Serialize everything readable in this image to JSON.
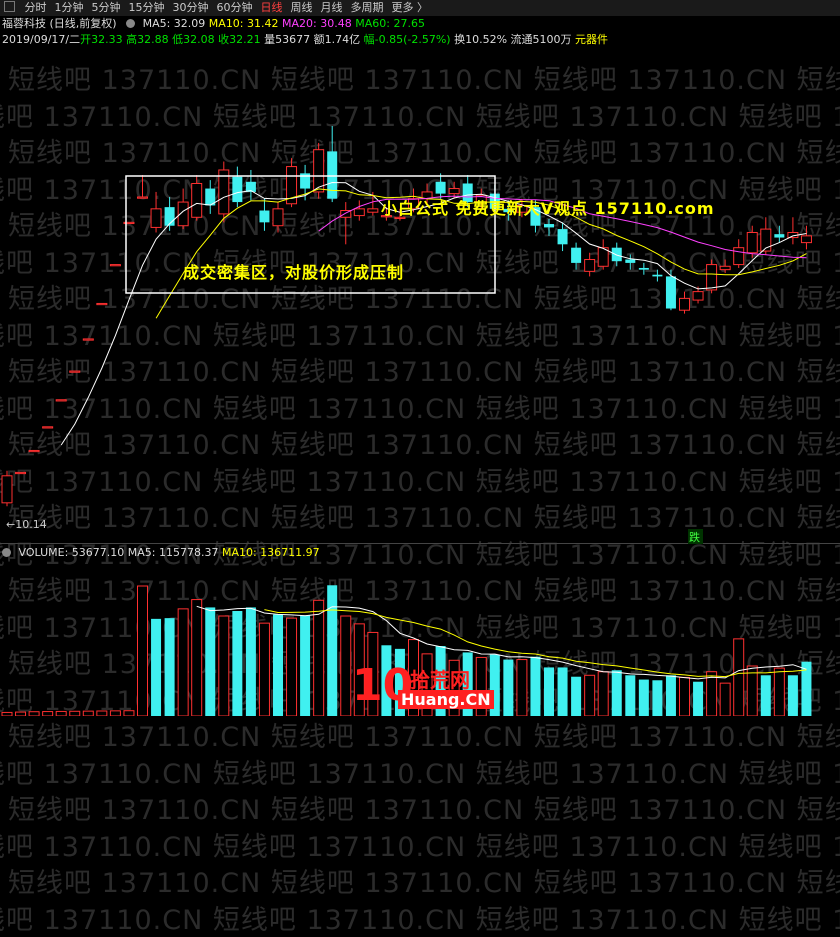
{
  "tabs": [
    {
      "label": "分时",
      "active": false
    },
    {
      "label": "1分钟",
      "active": false
    },
    {
      "label": "5分钟",
      "active": false
    },
    {
      "label": "15分钟",
      "active": false
    },
    {
      "label": "30分钟",
      "active": false
    },
    {
      "label": "60分钟",
      "active": false
    },
    {
      "label": "日线",
      "active": true
    },
    {
      "label": "周线",
      "active": false
    },
    {
      "label": "月线",
      "active": false
    },
    {
      "label": "多周期",
      "active": false
    },
    {
      "label": "更多 〉",
      "active": false
    }
  ],
  "header": {
    "stock": "福蓉科技 (日线,前复权)",
    "ma5": "MA5: 32.09",
    "ma10": "MA10: 31.42",
    "ma20": "MA20: 30.48",
    "ma60": "MA60: 27.65",
    "date": "2019/09/17/二",
    "open": "开32.33",
    "high": "高32.88",
    "low": "低32.08",
    "close": "收32.21",
    "volume": "量53677",
    "amount": "额1.74亿",
    "change": "幅-0.85(-2.57%)",
    "turnover": "换10.52%",
    "float": "流通5100万",
    "tool": "元器件"
  },
  "volume_header": {
    "volume": "VOLUME: 53677.10",
    "ma5": "MA5: 115778.37",
    "ma10": "MA10: 136711.97"
  },
  "annotations": {
    "dense_zone": "成交密集区，对股价形成压制",
    "promo": "小白公式 免费更新大V观点 157110.com"
  },
  "low_label": "←10.14",
  "badge": "跌",
  "watermark": "短线吧 137110.CN",
  "logo": {
    "ten": "10",
    "cn1": "拾荒网",
    "cn2": "Huang.CN"
  },
  "colors": {
    "up": "#ff3030",
    "down": "#40f0f0",
    "ma5": "#ffffff",
    "ma10": "#ffff00",
    "ma20": "#ff40ff",
    "ma60": "#00e000"
  },
  "chart_data": {
    "type": "candlestick",
    "price_ylim": [
      9,
      38
    ],
    "candles": [
      {
        "o": 11.2,
        "c": 12.8,
        "h": 13.1,
        "l": 11.0
      },
      {
        "o": 13.0,
        "c": 13.0,
        "h": 13.0,
        "l": 13.0
      },
      {
        "o": 14.3,
        "c": 14.3,
        "h": 14.3,
        "l": 14.3
      },
      {
        "o": 15.7,
        "c": 15.7,
        "h": 15.7,
        "l": 15.7
      },
      {
        "o": 17.3,
        "c": 17.3,
        "h": 17.3,
        "l": 17.3
      },
      {
        "o": 19.0,
        "c": 19.0,
        "h": 19.0,
        "l": 19.0
      },
      {
        "o": 20.9,
        "c": 20.9,
        "h": 20.9,
        "l": 20.9
      },
      {
        "o": 23.0,
        "c": 23.0,
        "h": 23.0,
        "l": 23.0
      },
      {
        "o": 25.3,
        "c": 25.3,
        "h": 25.3,
        "l": 25.3
      },
      {
        "o": 27.8,
        "c": 27.8,
        "h": 27.8,
        "l": 27.8
      },
      {
        "o": 29.3,
        "c": 29.3,
        "h": 30.6,
        "l": 29.3
      },
      {
        "o": 27.5,
        "c": 28.6,
        "h": 29.6,
        "l": 27.2
      },
      {
        "o": 28.7,
        "c": 27.6,
        "h": 29.3,
        "l": 27.3
      },
      {
        "o": 27.6,
        "c": 29.0,
        "h": 29.8,
        "l": 27.4
      },
      {
        "o": 28.1,
        "c": 30.1,
        "h": 30.6,
        "l": 27.9
      },
      {
        "o": 29.8,
        "c": 28.8,
        "h": 30.3,
        "l": 28.3
      },
      {
        "o": 28.3,
        "c": 30.9,
        "h": 31.4,
        "l": 27.8
      },
      {
        "o": 30.5,
        "c": 29.0,
        "h": 31.1,
        "l": 28.7
      },
      {
        "o": 30.2,
        "c": 29.6,
        "h": 30.9,
        "l": 29.1
      },
      {
        "o": 28.5,
        "c": 27.8,
        "h": 29.2,
        "l": 27.3
      },
      {
        "o": 27.6,
        "c": 28.6,
        "h": 29.0,
        "l": 27.2
      },
      {
        "o": 28.9,
        "c": 31.1,
        "h": 31.6,
        "l": 28.7
      },
      {
        "o": 30.7,
        "c": 29.8,
        "h": 31.2,
        "l": 29.1
      },
      {
        "o": 29.6,
        "c": 32.1,
        "h": 32.5,
        "l": 29.2
      },
      {
        "o": 32.0,
        "c": 29.2,
        "h": 33.5,
        "l": 29.0
      },
      {
        "o": 28.1,
        "c": 28.5,
        "h": 29.0,
        "l": 26.5
      },
      {
        "o": 28.2,
        "c": 28.6,
        "h": 29.1,
        "l": 27.9
      },
      {
        "o": 28.4,
        "c": 28.6,
        "h": 29.6,
        "l": 28.2
      },
      {
        "o": 28.2,
        "c": 28.2,
        "h": 28.7,
        "l": 27.9
      },
      {
        "o": 28.1,
        "c": 28.1,
        "h": 28.6,
        "l": 27.9
      },
      {
        "o": 28.6,
        "c": 29.2,
        "h": 29.8,
        "l": 28.4
      },
      {
        "o": 29.2,
        "c": 29.6,
        "h": 30.1,
        "l": 28.9
      },
      {
        "o": 30.2,
        "c": 29.5,
        "h": 30.7,
        "l": 29.2
      },
      {
        "o": 29.5,
        "c": 29.8,
        "h": 30.2,
        "l": 29.2
      },
      {
        "o": 30.1,
        "c": 29.0,
        "h": 30.6,
        "l": 28.7
      },
      {
        "o": 29.0,
        "c": 29.4,
        "h": 29.8,
        "l": 28.6
      },
      {
        "o": 29.5,
        "c": 28.6,
        "h": 30.0,
        "l": 28.3
      },
      {
        "o": 28.6,
        "c": 28.4,
        "h": 29.1,
        "l": 27.9
      },
      {
        "o": 28.4,
        "c": 28.8,
        "h": 29.2,
        "l": 28.1
      },
      {
        "o": 28.7,
        "c": 27.6,
        "h": 29.1,
        "l": 27.2
      },
      {
        "o": 27.7,
        "c": 27.5,
        "h": 28.0,
        "l": 27.0
      },
      {
        "o": 27.4,
        "c": 26.5,
        "h": 27.8,
        "l": 26.1
      },
      {
        "o": 26.3,
        "c": 25.4,
        "h": 26.6,
        "l": 25.0
      },
      {
        "o": 24.9,
        "c": 25.6,
        "h": 26.0,
        "l": 24.6
      },
      {
        "o": 25.2,
        "c": 26.3,
        "h": 26.8,
        "l": 25.0
      },
      {
        "o": 26.3,
        "c": 25.5,
        "h": 26.6,
        "l": 25.2
      },
      {
        "o": 25.6,
        "c": 25.4,
        "h": 25.9,
        "l": 25.0
      },
      {
        "o": 25.1,
        "c": 25.0,
        "h": 25.4,
        "l": 24.7
      },
      {
        "o": 24.7,
        "c": 24.6,
        "h": 25.0,
        "l": 24.3
      },
      {
        "o": 24.6,
        "c": 22.7,
        "h": 25.0,
        "l": 22.6
      },
      {
        "o": 22.6,
        "c": 23.3,
        "h": 23.7,
        "l": 22.4
      },
      {
        "o": 23.2,
        "c": 23.7,
        "h": 24.0,
        "l": 23.0
      },
      {
        "o": 23.8,
        "c": 25.3,
        "h": 25.6,
        "l": 23.6
      },
      {
        "o": 25.0,
        "c": 25.2,
        "h": 25.6,
        "l": 24.8
      },
      {
        "o": 25.3,
        "c": 26.3,
        "h": 26.8,
        "l": 25.1
      },
      {
        "o": 26.0,
        "c": 27.2,
        "h": 27.6,
        "l": 25.7
      },
      {
        "o": 26.1,
        "c": 27.4,
        "h": 28.1,
        "l": 25.9
      },
      {
        "o": 27.1,
        "c": 26.9,
        "h": 27.6,
        "l": 26.6
      },
      {
        "o": 26.9,
        "c": 27.2,
        "h": 28.1,
        "l": 26.5
      },
      {
        "o": 26.6,
        "c": 27.0,
        "h": 27.6,
        "l": 26.2
      }
    ],
    "volumes": [
      {
        "v": 5000,
        "up": true
      },
      {
        "v": 5500,
        "up": true
      },
      {
        "v": 6000,
        "up": true
      },
      {
        "v": 6200,
        "up": true
      },
      {
        "v": 6400,
        "up": true
      },
      {
        "v": 6600,
        "up": true
      },
      {
        "v": 6800,
        "up": true
      },
      {
        "v": 7000,
        "up": true
      },
      {
        "v": 7200,
        "up": true
      },
      {
        "v": 7400,
        "up": true
      },
      {
        "v": 182000,
        "up": true
      },
      {
        "v": 136000,
        "up": false
      },
      {
        "v": 137000,
        "up": false
      },
      {
        "v": 150000,
        "up": true
      },
      {
        "v": 163000,
        "up": true
      },
      {
        "v": 152000,
        "up": false
      },
      {
        "v": 140000,
        "up": true
      },
      {
        "v": 147000,
        "up": false
      },
      {
        "v": 152000,
        "up": false
      },
      {
        "v": 130000,
        "up": true
      },
      {
        "v": 142000,
        "up": false
      },
      {
        "v": 137000,
        "up": true
      },
      {
        "v": 141000,
        "up": false
      },
      {
        "v": 162000,
        "up": true
      },
      {
        "v": 183000,
        "up": false
      },
      {
        "v": 140000,
        "up": true
      },
      {
        "v": 129000,
        "up": true
      },
      {
        "v": 117000,
        "up": true
      },
      {
        "v": 99000,
        "up": false
      },
      {
        "v": 94000,
        "up": false
      },
      {
        "v": 107000,
        "up": true
      },
      {
        "v": 87000,
        "up": true
      },
      {
        "v": 98000,
        "up": false
      },
      {
        "v": 78000,
        "up": true
      },
      {
        "v": 89000,
        "up": false
      },
      {
        "v": 82000,
        "up": true
      },
      {
        "v": 86000,
        "up": false
      },
      {
        "v": 79000,
        "up": false
      },
      {
        "v": 79000,
        "up": true
      },
      {
        "v": 83000,
        "up": false
      },
      {
        "v": 68000,
        "up": false
      },
      {
        "v": 68000,
        "up": false
      },
      {
        "v": 55000,
        "up": false
      },
      {
        "v": 57000,
        "up": true
      },
      {
        "v": 62000,
        "up": true
      },
      {
        "v": 64000,
        "up": false
      },
      {
        "v": 57000,
        "up": false
      },
      {
        "v": 51000,
        "up": false
      },
      {
        "v": 50000,
        "up": false
      },
      {
        "v": 57000,
        "up": false
      },
      {
        "v": 54000,
        "up": true
      },
      {
        "v": 48000,
        "up": false
      },
      {
        "v": 62000,
        "up": true
      },
      {
        "v": 46000,
        "up": true
      },
      {
        "v": 108000,
        "up": true
      },
      {
        "v": 70000,
        "up": true
      },
      {
        "v": 57000,
        "up": false
      },
      {
        "v": 67000,
        "up": true
      },
      {
        "v": 57000,
        "up": false
      },
      {
        "v": 76000,
        "up": false
      }
    ],
    "volume_ylim": [
      0,
      210000
    ]
  }
}
